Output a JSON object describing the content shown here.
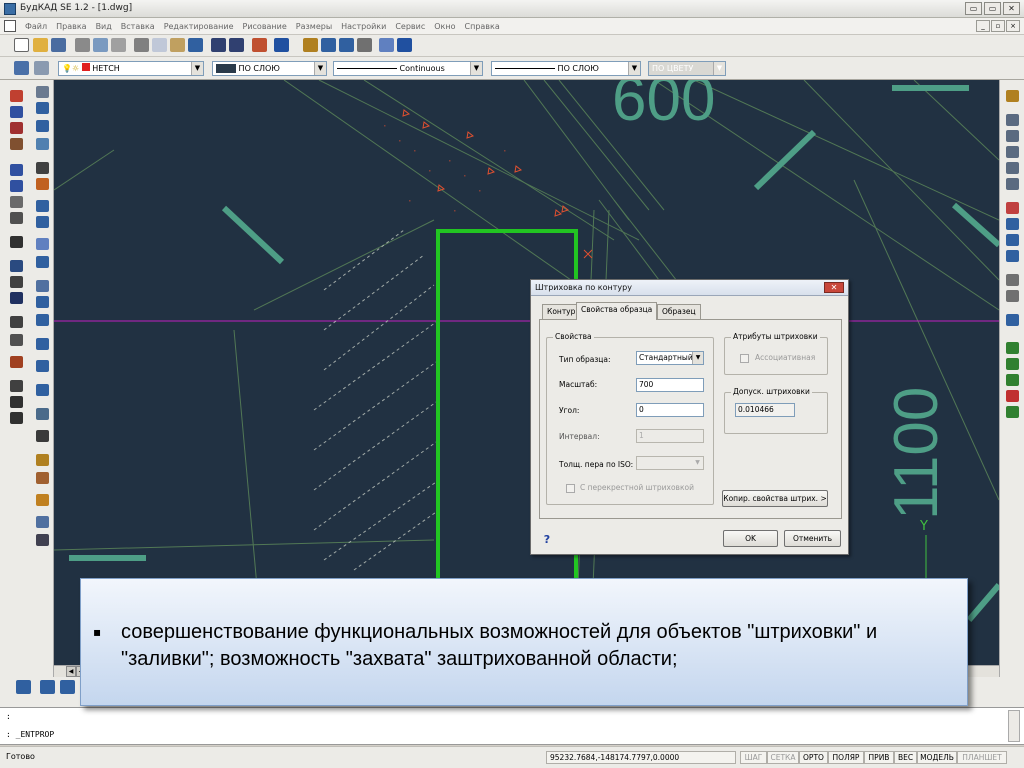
{
  "window": {
    "title": "БудКАД SE 1.2 - [1.dwg]",
    "buttons": [
      "▭",
      "▭",
      "✕"
    ]
  },
  "menu": {
    "items": [
      "Файл",
      "Правка",
      "Вид",
      "Вставка",
      "Редактирование",
      "Рисование",
      "Размеры",
      "Настройки",
      "Сервис",
      "Окно",
      "Справка"
    ]
  },
  "toolbar2": {
    "layer": "НЕТСН",
    "color": "ПО СЛОЮ",
    "linetype": "Continuous",
    "lineweight": "ПО СЛОЮ",
    "plotstyle": "ПО ЦВЕТУ"
  },
  "canvas": {
    "dim_top": "600",
    "dim_right": "1100",
    "axis_y": "Y"
  },
  "dialog": {
    "title": "Штриховка по контуру",
    "tabs": [
      "Контур",
      "Свойства образца",
      "Образец"
    ],
    "props_group": "Свойства",
    "type_label": "Тип образца:",
    "type_value": "Стандартный",
    "scale_label": "Масштаб:",
    "scale_value": "700",
    "angle_label": "Угол:",
    "angle_value": "0",
    "interval_label": "Интервал:",
    "interval_value": "1",
    "pen_label": "Толщ. пера по ISO:",
    "cross_label": "С перекрестной штриховкой",
    "attr_group": "Атрибуты штриховки",
    "assoc_label": "Ассоциативная",
    "tol_group": "Допуск. штриховки",
    "tol_value": "0.010466",
    "copy_btn": "Копир. свойства штрих. >",
    "help_btn": "?",
    "ok_btn": "OK",
    "cancel_btn": "Отменить"
  },
  "command": {
    "line1": ":",
    "line2": ": _ENTPROP"
  },
  "status": {
    "ready": "Готово",
    "coords": "95232.7684,-148174.7797,0.0000",
    "buttons": [
      "ШАГ",
      "СЕТКА",
      "ОРТО",
      "ПОЛЯР",
      "ПРИВ",
      "ВЕС",
      "МОДЕЛЬ",
      "ПЛАНШЕТ"
    ]
  },
  "slide": {
    "bullet": "▪",
    "text": "совершенствование функциональных возможностей для объектов \"штриховки\" и \"заливки\"; возможность \"захвата\" заштрихованной области;"
  },
  "colors": {
    "canvas": "#213142",
    "green": "#2bd22b",
    "dim_teal": "#4e9e86",
    "magenta": "#c020c0"
  }
}
